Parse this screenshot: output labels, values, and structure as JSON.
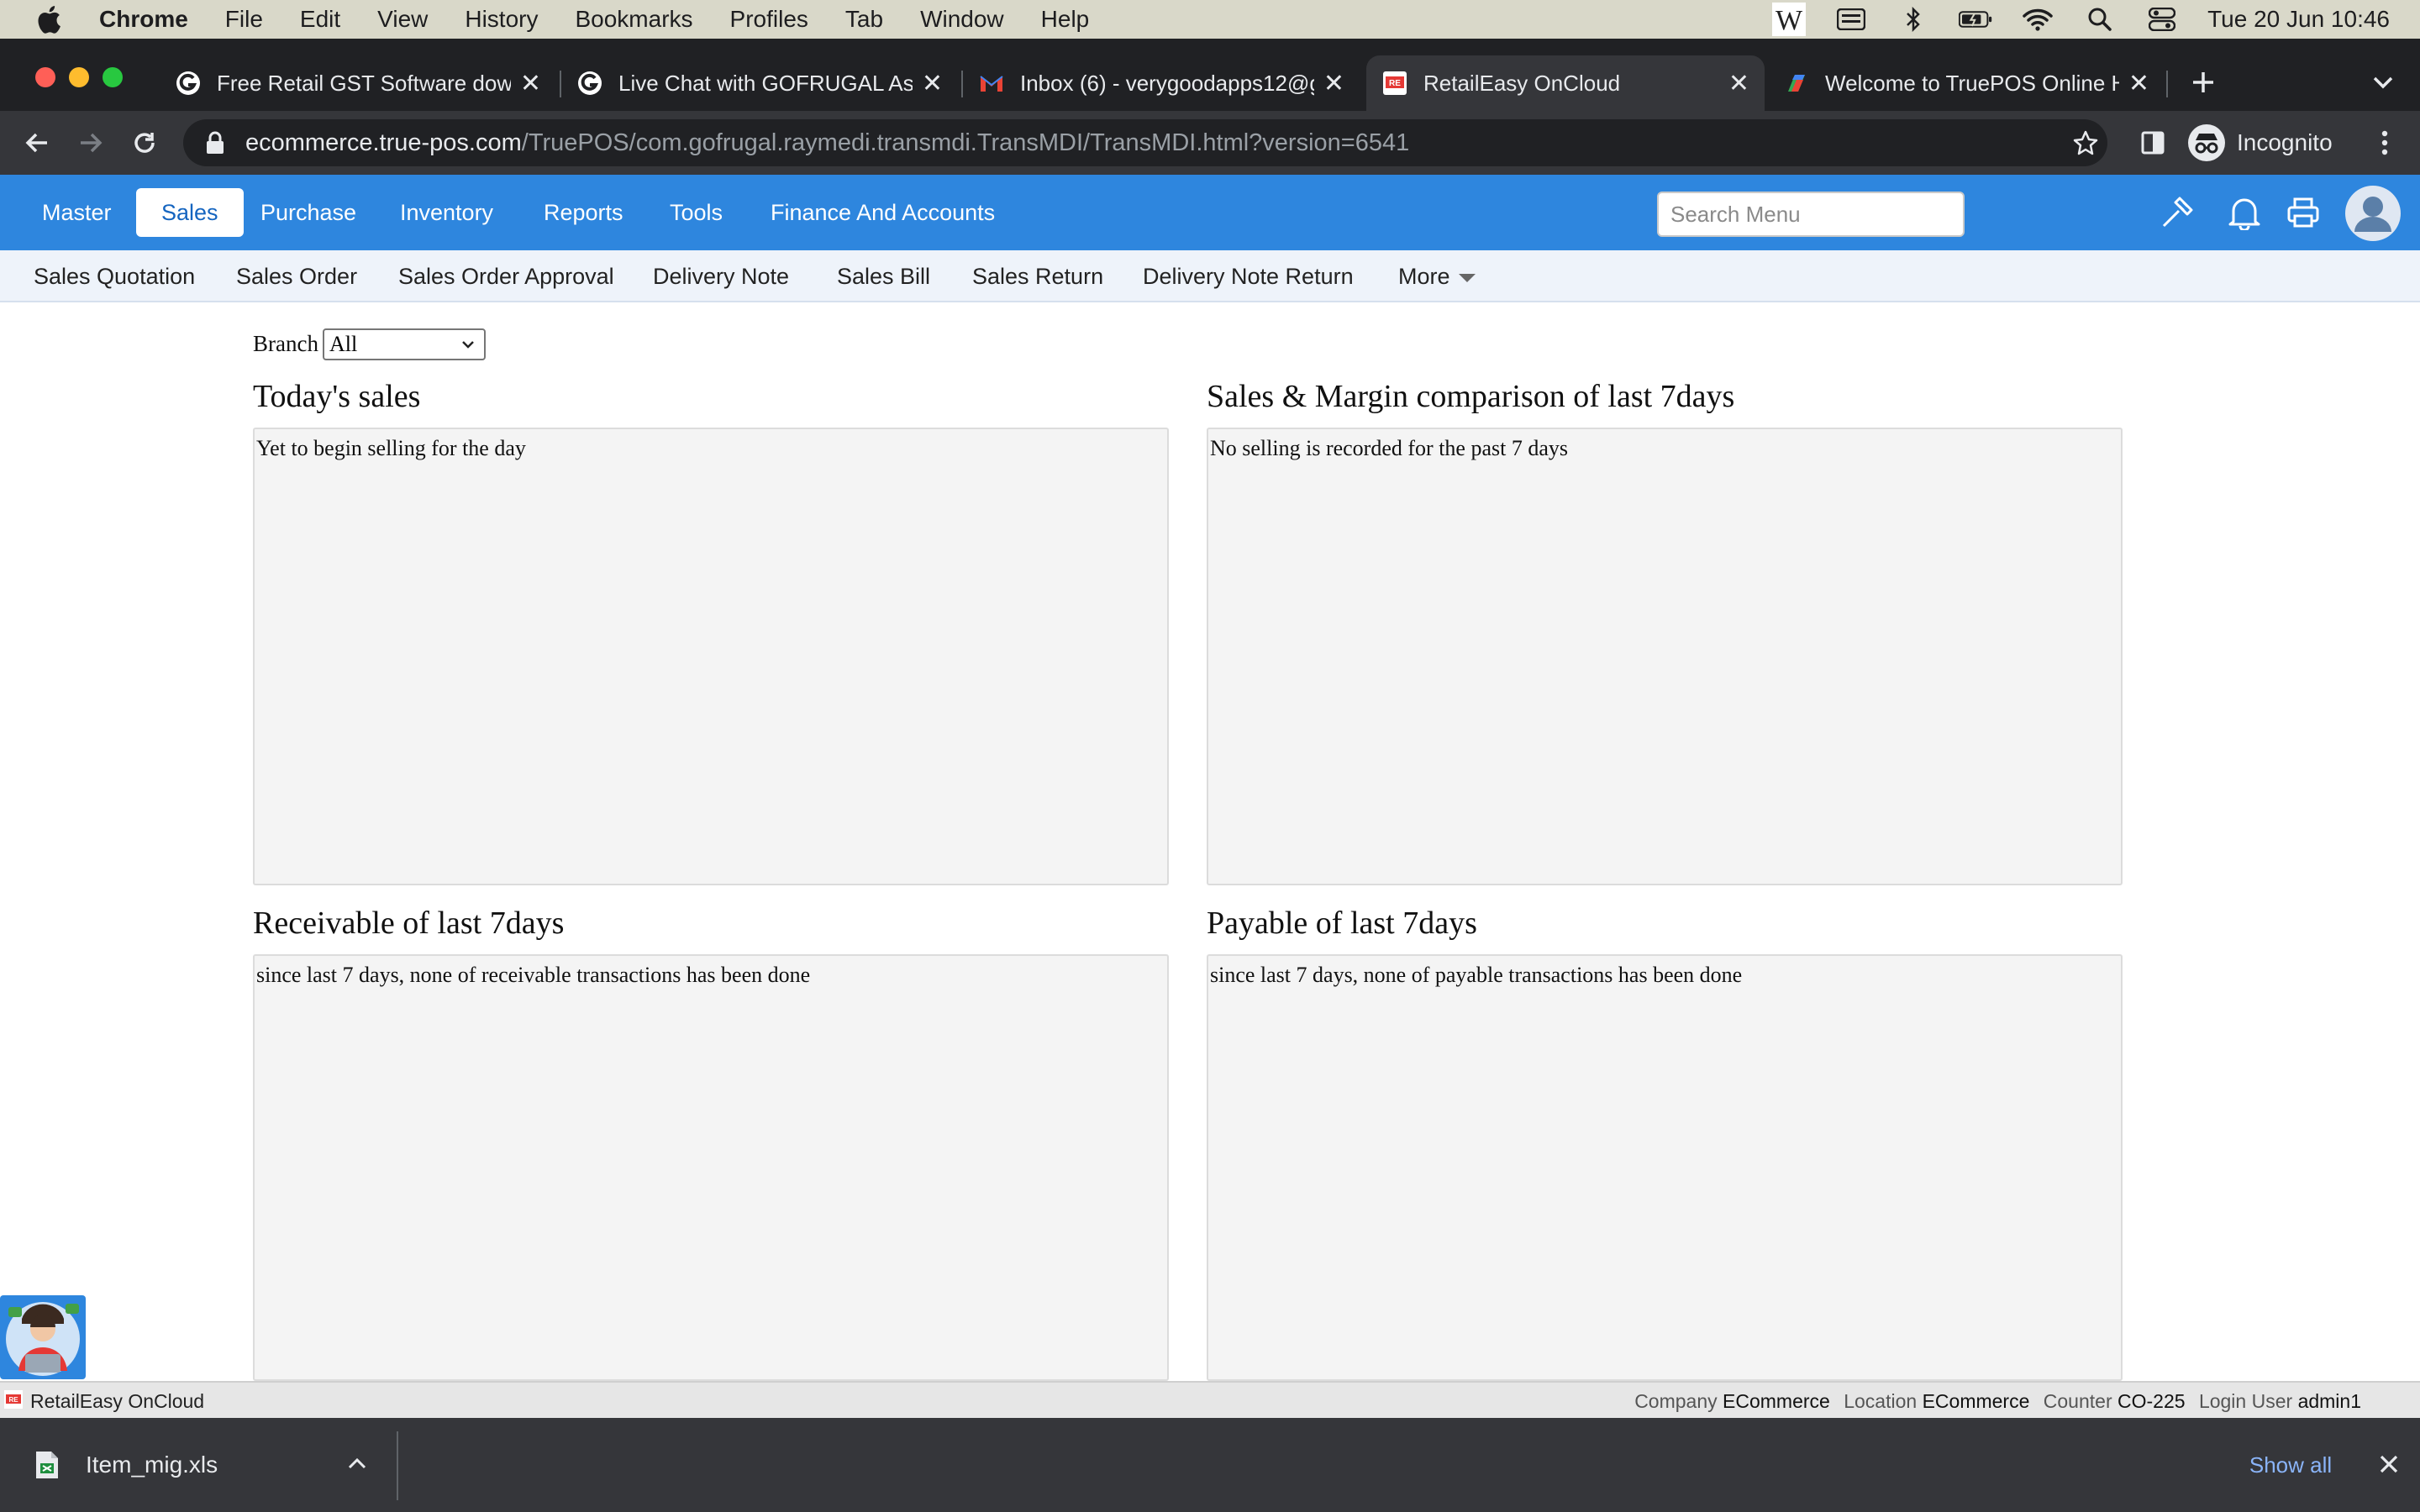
{
  "mac_menu": {
    "app": "Chrome",
    "items": [
      "File",
      "Edit",
      "View",
      "History",
      "Bookmarks",
      "Profiles",
      "Tab",
      "Window",
      "Help"
    ],
    "clock": "Tue 20 Jun  10:46",
    "status_icons": [
      "w-icon",
      "keyboard-icon",
      "bluetooth-icon",
      "battery-icon",
      "wifi-icon",
      "spotlight-search-icon",
      "control-center-icon"
    ]
  },
  "browser": {
    "tabs": [
      {
        "title": "Free Retail GST Software downl",
        "favicon": "gofrugal-icon"
      },
      {
        "title": "Live Chat with GOFRUGAL Assi",
        "favicon": "gofrugal-icon"
      },
      {
        "title": "Inbox (6) - verygoodapps12@g",
        "favicon": "gmail-icon"
      },
      {
        "title": "RetailEasy OnCloud",
        "favicon": "retaileasy-icon",
        "active": true
      },
      {
        "title": "Welcome to TruePOS Online He",
        "favicon": "truepos-icon"
      }
    ],
    "url_host": "ecommerce.true-pos.com",
    "url_path": "/TruePOS/com.gofrugal.raymedi.transmdi.TransMDI/TransMDI.html?version=6541",
    "profile_label": "Incognito"
  },
  "app_nav": {
    "items": [
      "Master",
      "Sales",
      "Purchase",
      "Inventory",
      "Reports",
      "Tools",
      "Finance And Accounts"
    ],
    "active": "Sales",
    "search_placeholder": "Search Menu"
  },
  "sub_nav": {
    "items": [
      "Sales Quotation",
      "Sales Order",
      "Sales Order Approval",
      "Delivery Note",
      "Sales Bill",
      "Sales Return",
      "Delivery Note Return"
    ],
    "more_label": "More"
  },
  "filters": {
    "branch_label": "Branch",
    "branch_value": "All"
  },
  "panels": {
    "today_sales": {
      "title": "Today's sales",
      "message": "Yet to begin selling for the day"
    },
    "sales_margin": {
      "title": "Sales & Margin comparison of last 7days",
      "message": "No selling is recorded for the past 7 days"
    },
    "receivable": {
      "title": "Receivable of last 7days",
      "message": "since last 7 days, none of receivable transactions has been done"
    },
    "payable": {
      "title": "Payable of last 7days",
      "message": "since last 7 days, none of payable transactions has been done"
    }
  },
  "status_bar": {
    "app_name": "RetailEasy OnCloud",
    "company_label": "Company",
    "company_value": "ECommerce",
    "location_label": "Location",
    "location_value": "ECommerce",
    "counter_label": "Counter",
    "counter_value": "CO-225",
    "user_label": "Login User",
    "user_value": "admin1"
  },
  "download_bar": {
    "file_name": "Item_mig.xls",
    "show_all_label": "Show all"
  },
  "colors": {
    "app_nav_bg": "#2e86de",
    "sub_nav_bg": "#eef3fa",
    "panel_bg": "#f4f4f4",
    "chrome_dark": "#202124"
  }
}
